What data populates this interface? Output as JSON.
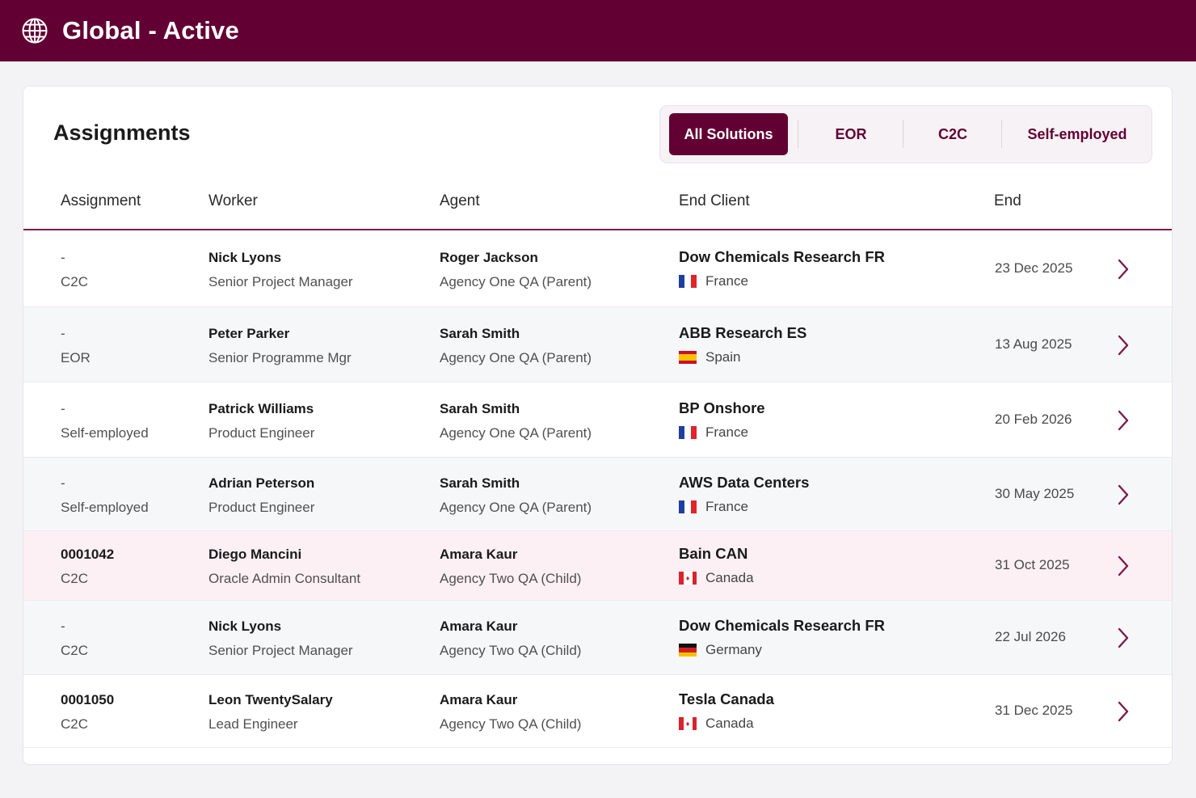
{
  "header": {
    "title": "Global - Active",
    "icon": "globe-icon",
    "bg_color": "#620033"
  },
  "card": {
    "title": "Assignments",
    "filters": [
      {
        "label": "All Solutions",
        "active": true
      },
      {
        "label": "EOR",
        "active": false
      },
      {
        "label": "C2C",
        "active": false
      },
      {
        "label": "Self-employed",
        "active": false
      }
    ]
  },
  "table": {
    "columns": [
      "Assignment",
      "Worker",
      "Agent",
      "End Client",
      "End"
    ],
    "rows": [
      {
        "assignment_id": "-",
        "assignment_type": "C2C",
        "worker_name": "Nick Lyons",
        "worker_role": "Senior Project Manager",
        "agent_name": "Roger Jackson",
        "agent_org": "Agency One QA (Parent)",
        "client_name": "Dow Chemicals Research FR",
        "client_country": "France",
        "flag": "fr",
        "end_date": "23 Dec 2025",
        "highlight": false
      },
      {
        "assignment_id": "-",
        "assignment_type": "EOR",
        "worker_name": "Peter Parker",
        "worker_role": "Senior Programme Mgr",
        "agent_name": "Sarah Smith",
        "agent_org": "Agency One QA (Parent)",
        "client_name": "ABB Research ES",
        "client_country": "Spain",
        "flag": "es",
        "end_date": "13 Aug 2025",
        "highlight": false
      },
      {
        "assignment_id": "-",
        "assignment_type": "Self-employed",
        "worker_name": "Patrick Williams",
        "worker_role": "Product Engineer",
        "agent_name": "Sarah Smith",
        "agent_org": "Agency One QA (Parent)",
        "client_name": "BP Onshore",
        "client_country": "France",
        "flag": "fr",
        "end_date": "20 Feb 2026",
        "highlight": false
      },
      {
        "assignment_id": "-",
        "assignment_type": "Self-employed",
        "worker_name": "Adrian Peterson",
        "worker_role": "Product Engineer",
        "agent_name": "Sarah Smith",
        "agent_org": "Agency One QA (Parent)",
        "client_name": "AWS Data Centers",
        "client_country": "France",
        "flag": "fr",
        "end_date": "30 May 2025",
        "highlight": false
      },
      {
        "assignment_id": "0001042",
        "assignment_type": "C2C",
        "worker_name": "Diego Mancini",
        "worker_role": "Oracle Admin Consultant",
        "agent_name": "Amara Kaur",
        "agent_org": "Agency Two QA (Child)",
        "client_name": "Bain CAN",
        "client_country": "Canada",
        "flag": "ca",
        "end_date": "31 Oct 2025",
        "highlight": true
      },
      {
        "assignment_id": "-",
        "assignment_type": "C2C",
        "worker_name": "Nick Lyons",
        "worker_role": "Senior Project Manager",
        "agent_name": "Amara Kaur",
        "agent_org": "Agency Two QA (Child)",
        "client_name": "Dow Chemicals Research FR",
        "client_country": "Germany",
        "flag": "de",
        "end_date": "22 Jul 2026",
        "highlight": false
      },
      {
        "assignment_id": "0001050",
        "assignment_type": "C2C",
        "worker_name": "Leon TwentySalary",
        "worker_role": "Lead Engineer",
        "agent_name": "Amara Kaur",
        "agent_org": "Agency Two QA (Child)",
        "client_name": "Tesla Canada",
        "client_country": "Canada",
        "flag": "ca",
        "end_date": "31 Dec 2025",
        "highlight": false
      }
    ]
  },
  "colors": {
    "brand": "#620033",
    "row_highlight": "#fdf0f5",
    "row_alt": "#f6f7f9"
  }
}
